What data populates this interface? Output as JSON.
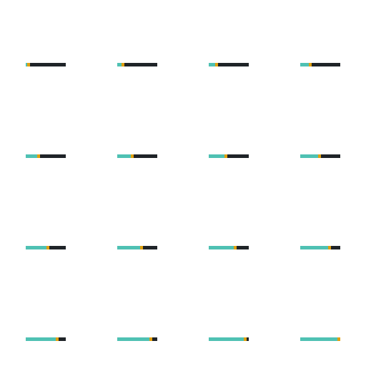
{
  "colors": {
    "track": "#1f2428",
    "fill": "#4fc1b3",
    "handle": "#e0a010",
    "background": "#ffffff"
  },
  "progress_bars": [
    {
      "progress": 0.04
    },
    {
      "progress": 0.11
    },
    {
      "progress": 0.18
    },
    {
      "progress": 0.24
    },
    {
      "progress": 0.3
    },
    {
      "progress": 0.37
    },
    {
      "progress": 0.43
    },
    {
      "progress": 0.49
    },
    {
      "progress": 0.56
    },
    {
      "progress": 0.62
    },
    {
      "progress": 0.68
    },
    {
      "progress": 0.75
    },
    {
      "progress": 0.81
    },
    {
      "progress": 0.87
    },
    {
      "progress": 0.94
    },
    {
      "progress": 1.0
    }
  ]
}
